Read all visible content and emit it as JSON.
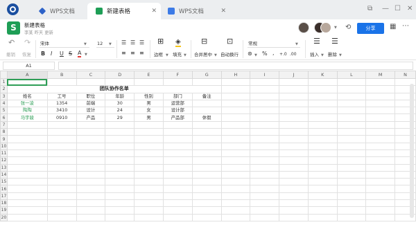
{
  "tabs": [
    {
      "label": "WPS文档",
      "icon": "wps-docs-icon"
    },
    {
      "label": "新建表格",
      "icon": "spreadsheet-icon"
    },
    {
      "label": "WPS文档",
      "icon": "word-doc-icon"
    }
  ],
  "titlebar": {
    "doc_title": "新建表格",
    "subtitle": "李某 昨天 更新",
    "share_label": "分享"
  },
  "ribbon": {
    "undo": "撤销",
    "redo": "恢复",
    "font_name": "宋体",
    "font_size": "12",
    "bold": "B",
    "italic": "I",
    "underline": "U",
    "strike": "S",
    "font_color_glyph": "A",
    "border": "边框",
    "fill": "填充",
    "merge": "合并居中",
    "wrap": "自动换行",
    "number_format": "常规",
    "percent": "%",
    "comma": ",",
    "insert": "插入",
    "delete": "删除"
  },
  "formula_bar": {
    "cell_ref": "A1",
    "value": ""
  },
  "sheet": {
    "columns": [
      "A",
      "B",
      "C",
      "D",
      "E",
      "F",
      "G",
      "H",
      "I",
      "J",
      "K",
      "L",
      "M",
      "N"
    ],
    "row_numbers": [
      "1",
      "2",
      "3",
      "4",
      "5",
      "6",
      "7",
      "8",
      "9",
      "10",
      "11",
      "12",
      "13",
      "14",
      "15",
      "16",
      "17",
      "18",
      "19",
      "20"
    ],
    "title": "团队协作名单",
    "headers": [
      "姓名",
      "工号",
      "职位",
      "年龄",
      "性别",
      "部门",
      "备注"
    ],
    "rows": [
      [
        "张一凌",
        "1354",
        "前端",
        "30",
        "男",
        "运营部",
        ""
      ],
      [
        "陶陶",
        "3410",
        "设计",
        "24",
        "女",
        "设计部",
        ""
      ],
      [
        "马宇骏",
        "0910",
        "产品",
        "29",
        "男",
        "产品部",
        "休假"
      ]
    ]
  },
  "colors": {
    "accent": "#1a73e8",
    "green_text": "#2e9e56",
    "sheet_logo": "#1e9e56"
  }
}
